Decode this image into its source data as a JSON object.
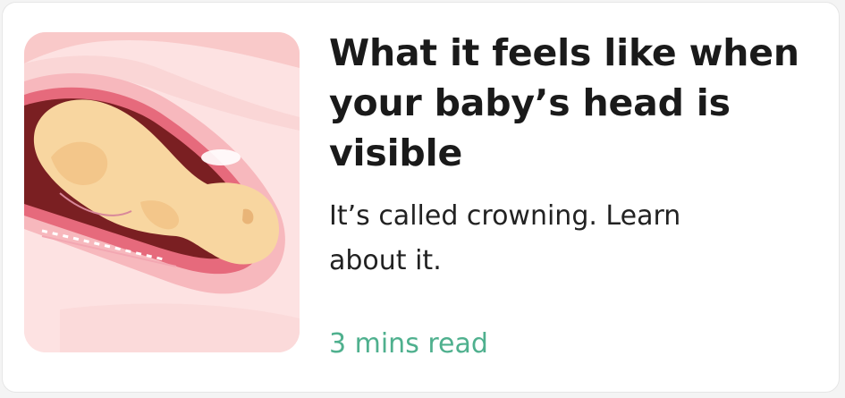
{
  "article": {
    "title": "What it feels like when your baby’s head is visible",
    "description": "It’s called crowning. Learn about it.",
    "read_time": "3 mins read",
    "accent_color": "#4fb08e",
    "thumbnail_icon": "baby-crowning-illustration"
  }
}
